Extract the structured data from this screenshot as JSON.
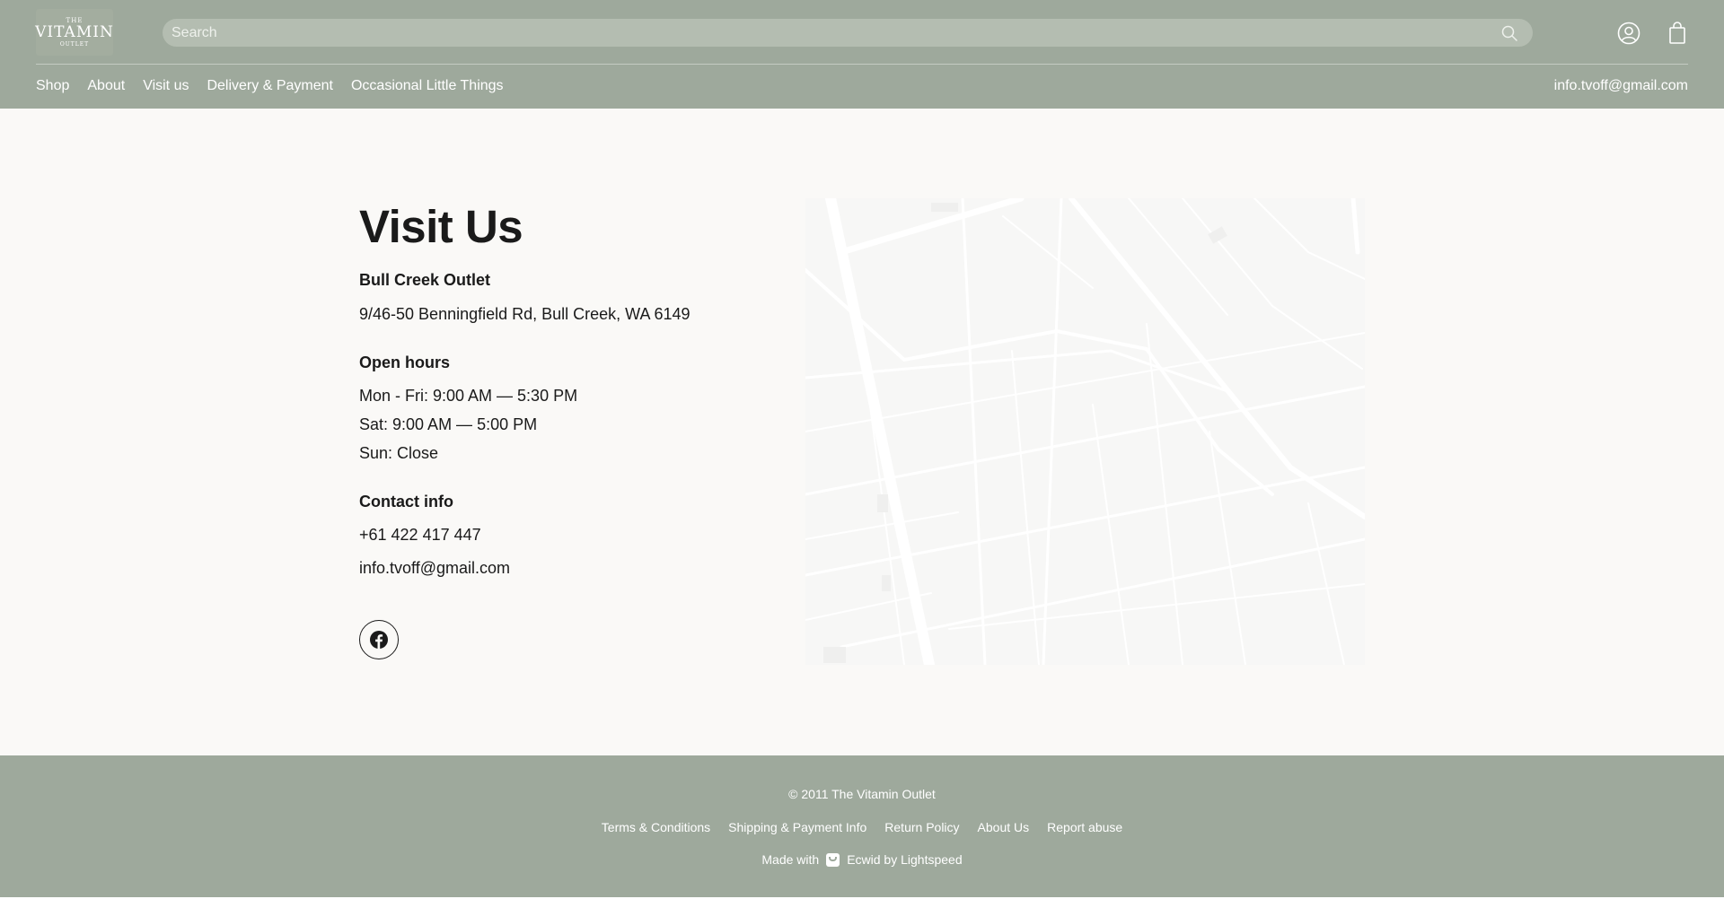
{
  "header": {
    "logo": {
      "line1": "THE",
      "line2": "VITAMIN",
      "line3": "OUTLET"
    },
    "search": {
      "placeholder": "Search"
    },
    "icons": {
      "search": "search-icon",
      "account": "user-icon",
      "cart": "shopping-bag-icon"
    },
    "nav": [
      "Shop",
      "About",
      "Visit us",
      "Delivery & Payment",
      "Occasional Little Things"
    ],
    "email": "info.tvoff@gmail.com"
  },
  "main": {
    "title": "Visit Us",
    "store": {
      "name": "Bull Creek Outlet",
      "address": "9/46-50 Benningfield Rd, Bull Creek, WA 6149"
    },
    "hours": {
      "title": "Open hours",
      "lines": [
        "Mon - Fri:  9:00 AM — 5:30 PM",
        "Sat:  9:00 AM — 5:00 PM",
        "Sun: Close"
      ]
    },
    "contact": {
      "title": "Contact info",
      "phone": "+61 422 417 447",
      "email": "info.tvoff@gmail.com"
    },
    "social": {
      "icon": "facebook-icon"
    }
  },
  "footer": {
    "copyright": "© 2011 The Vitamin Outlet",
    "links": [
      "Terms & Conditions",
      "Shipping & Payment Info",
      "Return Policy",
      "About Us",
      "Report abuse"
    ],
    "made_with_label": "Made with",
    "made_with_brand": "Ecwid by Lightspeed"
  },
  "colors": {
    "header_bg": "#9ea99c",
    "page_bg": "#faf9f7",
    "text": "#1a1a1a",
    "search_bg": "#b4bdb1"
  }
}
